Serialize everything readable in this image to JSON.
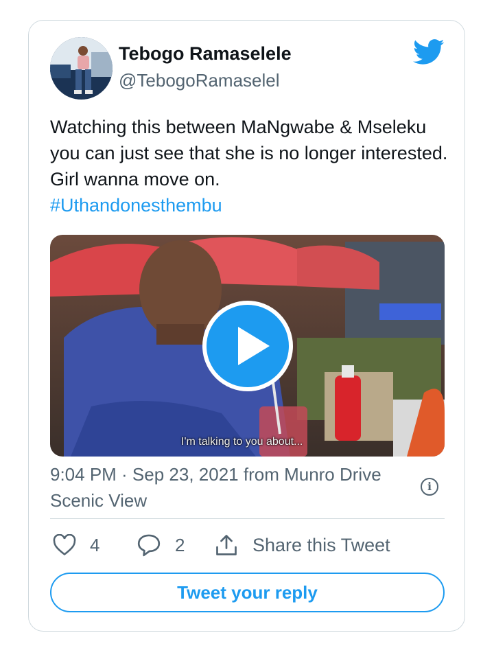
{
  "tweet": {
    "display_name": "Tebogo Ramaselele",
    "handle": "@TebogoRamaselel",
    "text": "Watching this between MaNgwabe & Mseleku you can just see that she is no longer interested. Girl wanna move on.",
    "hashtag": "#Uthandonesthembu",
    "video_subtitle": "I'm talking to you about...",
    "timestamp": "9:04 PM · Sep 23, 2021 from Munro Drive Scenic View"
  },
  "actions": {
    "likes": "4",
    "replies": "2",
    "share_label": "Share this Tweet"
  },
  "reply_button_label": "Tweet your reply",
  "colors": {
    "accent": "#1d9bf0",
    "secondary_text": "#536471",
    "border": "#cfd9de"
  },
  "icons": [
    "twitter-bird-icon",
    "play-icon",
    "info-icon",
    "heart-icon",
    "reply-bubble-icon",
    "share-icon"
  ]
}
